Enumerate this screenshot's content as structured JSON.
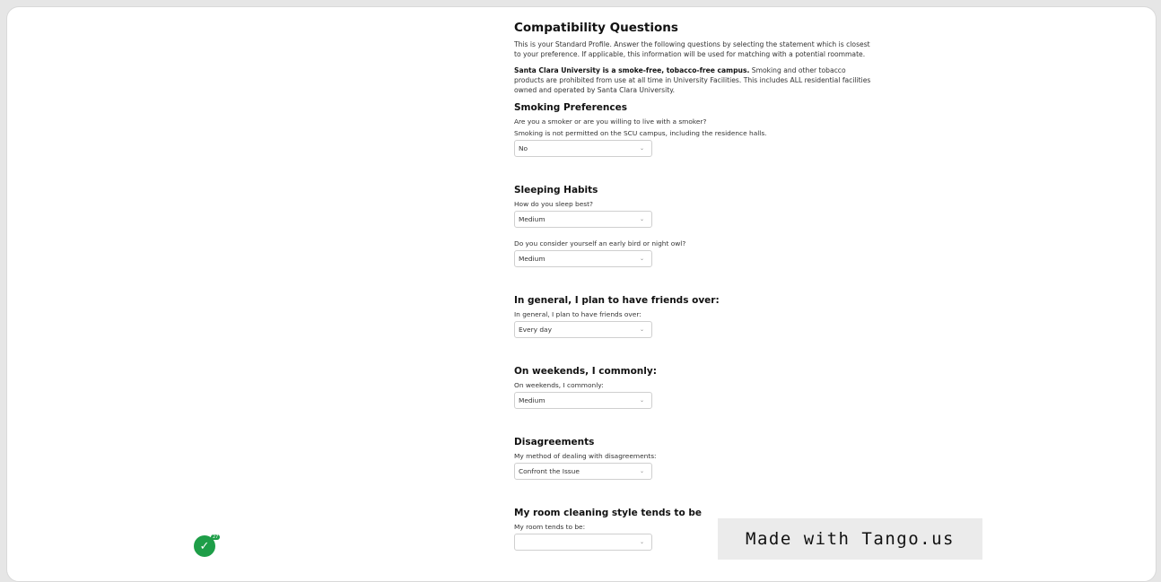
{
  "main": {
    "title": "Compatibility Questions",
    "intro": "This is your Standard Profile. Answer the following questions by selecting the statement which is closest to your preference. If applicable, this information will be used for matching with a potential roommate.",
    "smoke_notice_bold": "Santa Clara University is a smoke-free, tobacco-free campus.",
    "smoke_notice_rest": " Smoking and other tobacco products are prohibited from use at all time in University Facilities. This includes ALL residential facilities owned and operated by Santa Clara University."
  },
  "smoking": {
    "title": "Smoking Preferences",
    "q1": "Are you a smoker or are you willing to live with a smoker?",
    "q2": "Smoking is not permitted on the SCU campus, including the residence halls.",
    "value": "No"
  },
  "sleeping": {
    "title": "Sleeping Habits",
    "q1": "How do you sleep best?",
    "value1": "Medium",
    "q2": "Do you consider yourself an early bird or night owl?",
    "value2": "Medium"
  },
  "friends": {
    "title": "In general, I plan to have friends over:",
    "q": "In general, I plan to have friends over:",
    "value": "Every day"
  },
  "weekends": {
    "title": "On weekends, I commonly:",
    "q": "On weekends, I commonly:",
    "value": "Medium"
  },
  "disagreements": {
    "title": "Disagreements",
    "q": "My method of dealing with disagreements:",
    "value": "Confront the Issue"
  },
  "cleaning": {
    "title": "My room cleaning style tends to be",
    "q": "My room tends to be:"
  },
  "icons": {
    "chevron": "⌄",
    "check": "✓"
  },
  "badge": {
    "count": "27"
  },
  "watermark": "Made with Tango.us",
  "colors": {
    "badge_green": "#1e9e48",
    "watermark_bg": "#ebebeb"
  }
}
